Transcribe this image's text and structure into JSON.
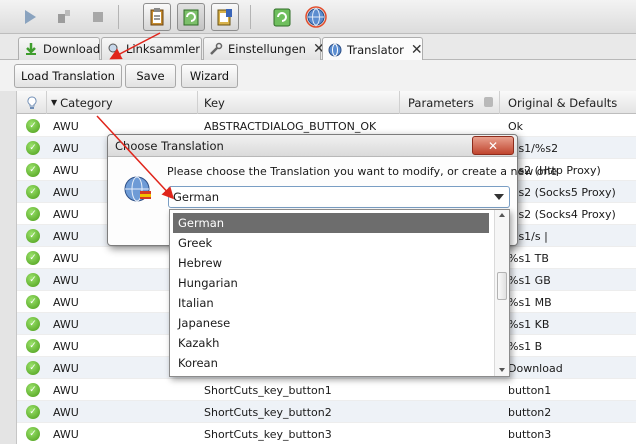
{
  "tabs": [
    {
      "label": "Download",
      "icon": "download-arrow-icon",
      "closable": false
    },
    {
      "label": "Linksammler",
      "icon": "linkgrabber-icon",
      "closable": true
    },
    {
      "label": "Einstellungen",
      "icon": "wrench-icon",
      "closable": true
    },
    {
      "label": "Translator",
      "icon": "globe-icon",
      "closable": true
    }
  ],
  "actions": {
    "load": "Load Translation",
    "save": "Save",
    "wizard": "Wizard"
  },
  "columns": {
    "category": "Category",
    "key": "Key",
    "parameters": "Parameters",
    "original": "Original & Defaults"
  },
  "rows": [
    {
      "category": "AWU",
      "key": "ABSTRACTDIALOG_BUTTON_OK",
      "original": "Ok"
    },
    {
      "category": "AWU",
      "key": "",
      "original": "%s1/%s2"
    },
    {
      "category": "AWU",
      "key": "",
      "original": "%s2 (Http Proxy)"
    },
    {
      "category": "AWU",
      "key": "",
      "original": "%s2 (Socks5 Proxy)"
    },
    {
      "category": "AWU",
      "key": "",
      "original": "%s2 (Socks4 Proxy)"
    },
    {
      "category": "AWU",
      "key": "",
      "original": "%s1/s |"
    },
    {
      "category": "AWU",
      "key": "",
      "original": "%s1 TB"
    },
    {
      "category": "AWU",
      "key": "",
      "original": "%s1 GB"
    },
    {
      "category": "AWU",
      "key": "",
      "original": "%s1 MB"
    },
    {
      "category": "AWU",
      "key": "",
      "original": "%s1 KB"
    },
    {
      "category": "AWU",
      "key": "",
      "original": "%s1 B"
    },
    {
      "category": "AWU",
      "key": "",
      "original": "Download"
    },
    {
      "category": "AWU",
      "key": "ShortCuts_key_button1",
      "original": "button1"
    },
    {
      "category": "AWU",
      "key": "ShortCuts_key_button2",
      "original": "button2"
    },
    {
      "category": "AWU",
      "key": "ShortCuts_key_button3",
      "original": "button3"
    }
  ],
  "dialog": {
    "title": "Choose Translation",
    "message": "Please choose the Translation you want to modify, or create a new one",
    "selected": "German",
    "close": "✕"
  },
  "dropdown": {
    "options": [
      "German",
      "Greek",
      "Hebrew",
      "Hungarian",
      "Italian",
      "Japanese",
      "Kazakh",
      "Korean"
    ],
    "selected_index": 0
  },
  "colors": {
    "accent": "#6d6d6d",
    "check": "#4a9b18",
    "close": "#c0452e"
  }
}
